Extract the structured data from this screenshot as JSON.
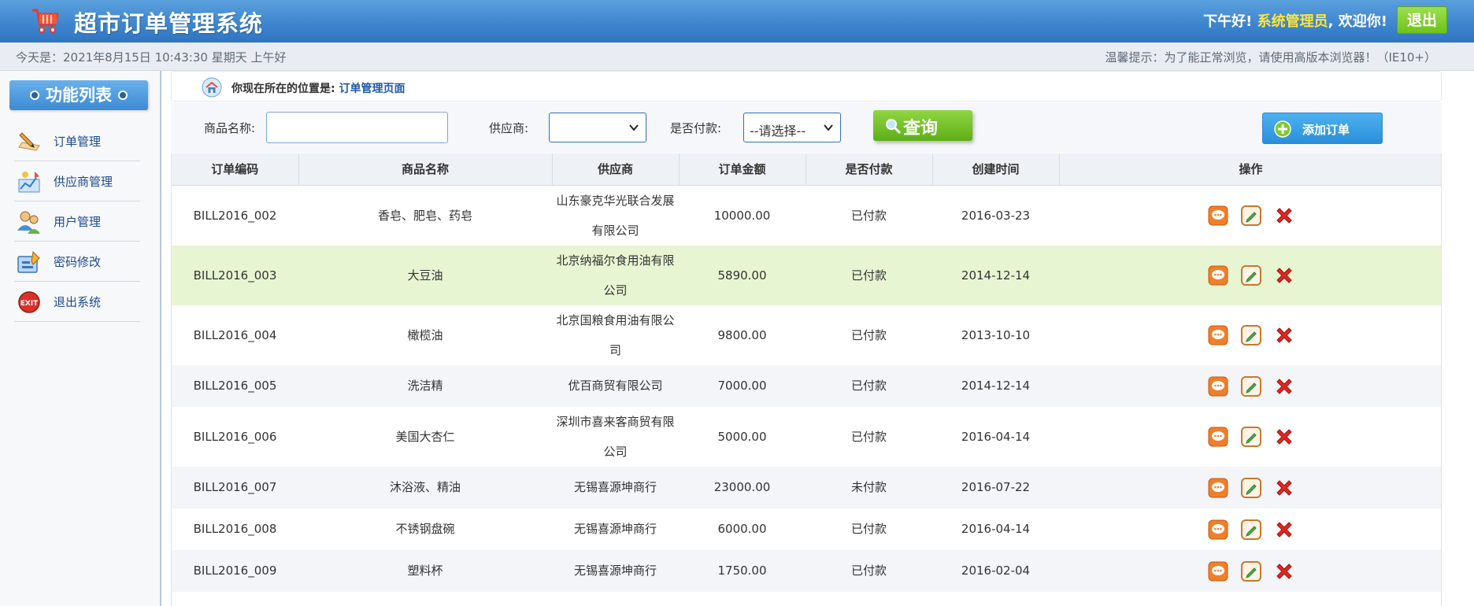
{
  "header": {
    "title": "超市订单管理系统",
    "greeting_prefix": "下午好!",
    "role": "系统管理员",
    "greeting_suffix": ", 欢迎你!",
    "logout_label": "退出",
    "brand_color": "#3f86cf"
  },
  "infobar": {
    "date_text": "今天是：2021年8月15日 10:43:30 星期天 上午好",
    "tip_text": "温馨提示：为了能正常浏览，请使用高版本浏览器！（IE10+）"
  },
  "sidebar": {
    "title": "功能列表",
    "items": [
      {
        "label": "订单管理",
        "icon": "order-pen-icon"
      },
      {
        "label": "供应商管理",
        "icon": "supplier-chart-icon"
      },
      {
        "label": "用户管理",
        "icon": "users-icon"
      },
      {
        "label": "密码修改",
        "icon": "password-edit-icon"
      },
      {
        "label": "退出系统",
        "icon": "exit-icon"
      }
    ]
  },
  "breadcrumb": {
    "prefix": "你现在所在的位置是:",
    "current": "订单管理页面"
  },
  "search": {
    "product_label": "商品名称:",
    "product_value": "",
    "supplier_label": "供应商:",
    "supplier_value": "",
    "paid_label": "是否付款:",
    "paid_value": "--请选择--",
    "query_label": "查询",
    "add_label": "添加订单"
  },
  "table": {
    "headers": [
      "订单编码",
      "商品名称",
      "供应商",
      "订单金额",
      "是否付款",
      "创建时间",
      "操作"
    ],
    "rows": [
      {
        "code": "BILL2016_002",
        "product": "香皂、肥皂、药皂",
        "supplier": "山东豪克华光联合发展有限公司",
        "amount": "10000.00",
        "paid": "已付款",
        "date": "2016-03-23"
      },
      {
        "code": "BILL2016_003",
        "product": "大豆油",
        "supplier": "北京纳福尔食用油有限公司",
        "amount": "5890.00",
        "paid": "已付款",
        "date": "2014-12-14"
      },
      {
        "code": "BILL2016_004",
        "product": "橄榄油",
        "supplier": "北京国粮食用油有限公司",
        "amount": "9800.00",
        "paid": "已付款",
        "date": "2013-10-10"
      },
      {
        "code": "BILL2016_005",
        "product": "洗洁精",
        "supplier": "优百商贸有限公司",
        "amount": "7000.00",
        "paid": "已付款",
        "date": "2014-12-14"
      },
      {
        "code": "BILL2016_006",
        "product": "美国大杏仁",
        "supplier": "深圳市喜来客商贸有限公司",
        "amount": "5000.00",
        "paid": "已付款",
        "date": "2016-04-14"
      },
      {
        "code": "BILL2016_007",
        "product": "沐浴液、精油",
        "supplier": "无锡喜源坤商行",
        "amount": "23000.00",
        "paid": "未付款",
        "date": "2016-07-22"
      },
      {
        "code": "BILL2016_008",
        "product": "不锈钢盘碗",
        "supplier": "无锡喜源坤商行",
        "amount": "6000.00",
        "paid": "已付款",
        "date": "2016-04-14"
      },
      {
        "code": "BILL2016_009",
        "product": "塑料杯",
        "supplier": "无锡喜源坤商行",
        "amount": "1750.00",
        "paid": "已付款",
        "date": "2016-02-04"
      }
    ],
    "actions": [
      "view-icon",
      "edit-icon",
      "delete-icon"
    ]
  }
}
